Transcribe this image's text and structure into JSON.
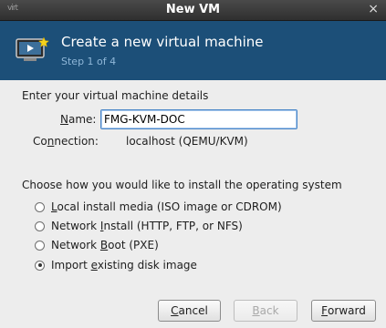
{
  "window": {
    "title": "New VM",
    "close_glyph": "×",
    "app_icon": "virt"
  },
  "header": {
    "title": "Create a new virtual machine",
    "step": "Step 1 of 4",
    "icon": "vm-wizard-icon",
    "bg_color": "#1c4f78"
  },
  "details": {
    "heading": "Enter your virtual machine details",
    "name_label_mnemonic": "N",
    "name_label_rest": "ame:",
    "name_value": "FMG-KVM-DOC",
    "connection_label_pre": "Co",
    "connection_label_mnemonic": "n",
    "connection_label_rest": "nection:",
    "connection_value": "localhost (QEMU/KVM)"
  },
  "install": {
    "heading": "Choose how you would like to install the operating system",
    "options": [
      {
        "pre": "",
        "mnemonic": "L",
        "rest": "ocal install media (ISO image or CDROM)",
        "checked": false
      },
      {
        "pre": "Network ",
        "mnemonic": "I",
        "rest": "nstall (HTTP, FTP, or NFS)",
        "checked": false
      },
      {
        "pre": "Network ",
        "mnemonic": "B",
        "rest": "oot (PXE)",
        "checked": false
      },
      {
        "pre": "Import ",
        "mnemonic": "e",
        "rest": "xisting disk image",
        "checked": true
      }
    ]
  },
  "buttons": {
    "cancel_mnemonic": "C",
    "cancel_rest": "ancel",
    "back_mnemonic": "B",
    "back_rest": "ack",
    "forward_mnemonic": "F",
    "forward_rest": "orward"
  }
}
